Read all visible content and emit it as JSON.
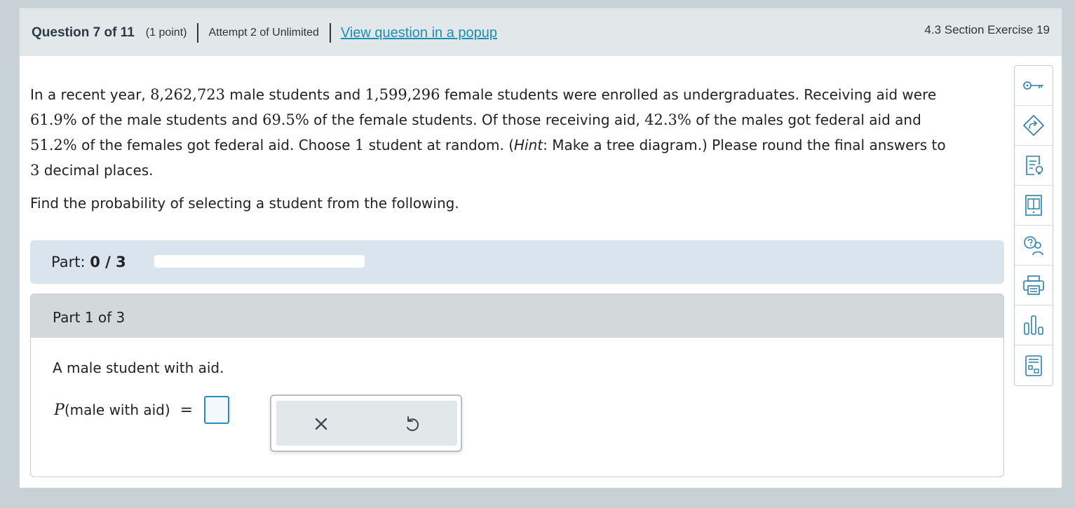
{
  "header": {
    "question_label": "Question 7 of 11",
    "points": "(1 point)",
    "attempt": "Attempt 2 of Unlimited",
    "popup_link": "View question in a popup",
    "section": "4.3 Section Exercise 19"
  },
  "question": {
    "line1_a": "In a recent year, ",
    "male_count": "8,262,723",
    "line1_b": " male students and ",
    "female_count": "1,599,296",
    "line1_c": " female students were enrolled as undergraduates. Receiving aid were",
    "male_aid_pct": "61.9%",
    "line2_a": " of the male students and ",
    "female_aid_pct": "69.5%",
    "line2_b": " of the female students. Of those receiving aid, ",
    "male_federal_pct": "42.3%",
    "line2_c": " of the males got federal aid and",
    "female_federal_pct": "51.2%",
    "line3_a": " of the females got federal aid. Choose ",
    "choose_count": "1",
    "line3_b": " student at random. (",
    "hint_word": "Hint",
    "line3_c": ": Make a tree diagram.) Please round the final answers to",
    "decimal_places": "3",
    "line4_a": " decimal places.",
    "find_text": "Find the probability of selecting a student from the following."
  },
  "parts": {
    "label": "Part:",
    "value": "0 / 3",
    "progress_fraction": 0
  },
  "part1": {
    "title": "Part 1 of 3",
    "description": "A male student with aid.",
    "eq_var": "P",
    "eq_text": "(male with aid)",
    "eq_sign": "=",
    "answer_value": ""
  },
  "tools": {
    "clear_icon": "x-icon",
    "reset_icon": "undo-icon"
  },
  "sidebar": {
    "items": [
      "key-icon",
      "share-arrow-icon",
      "ebook-hint-icon",
      "book-icon",
      "ask-help-icon",
      "print-icon",
      "bar-chart-icon",
      "calculator-icon"
    ]
  },
  "colors": {
    "accent": "#2b8cbf",
    "link": "#1a8fb5",
    "header_bg": "#e2e8e9",
    "parts_bg": "#d9e4ee"
  }
}
